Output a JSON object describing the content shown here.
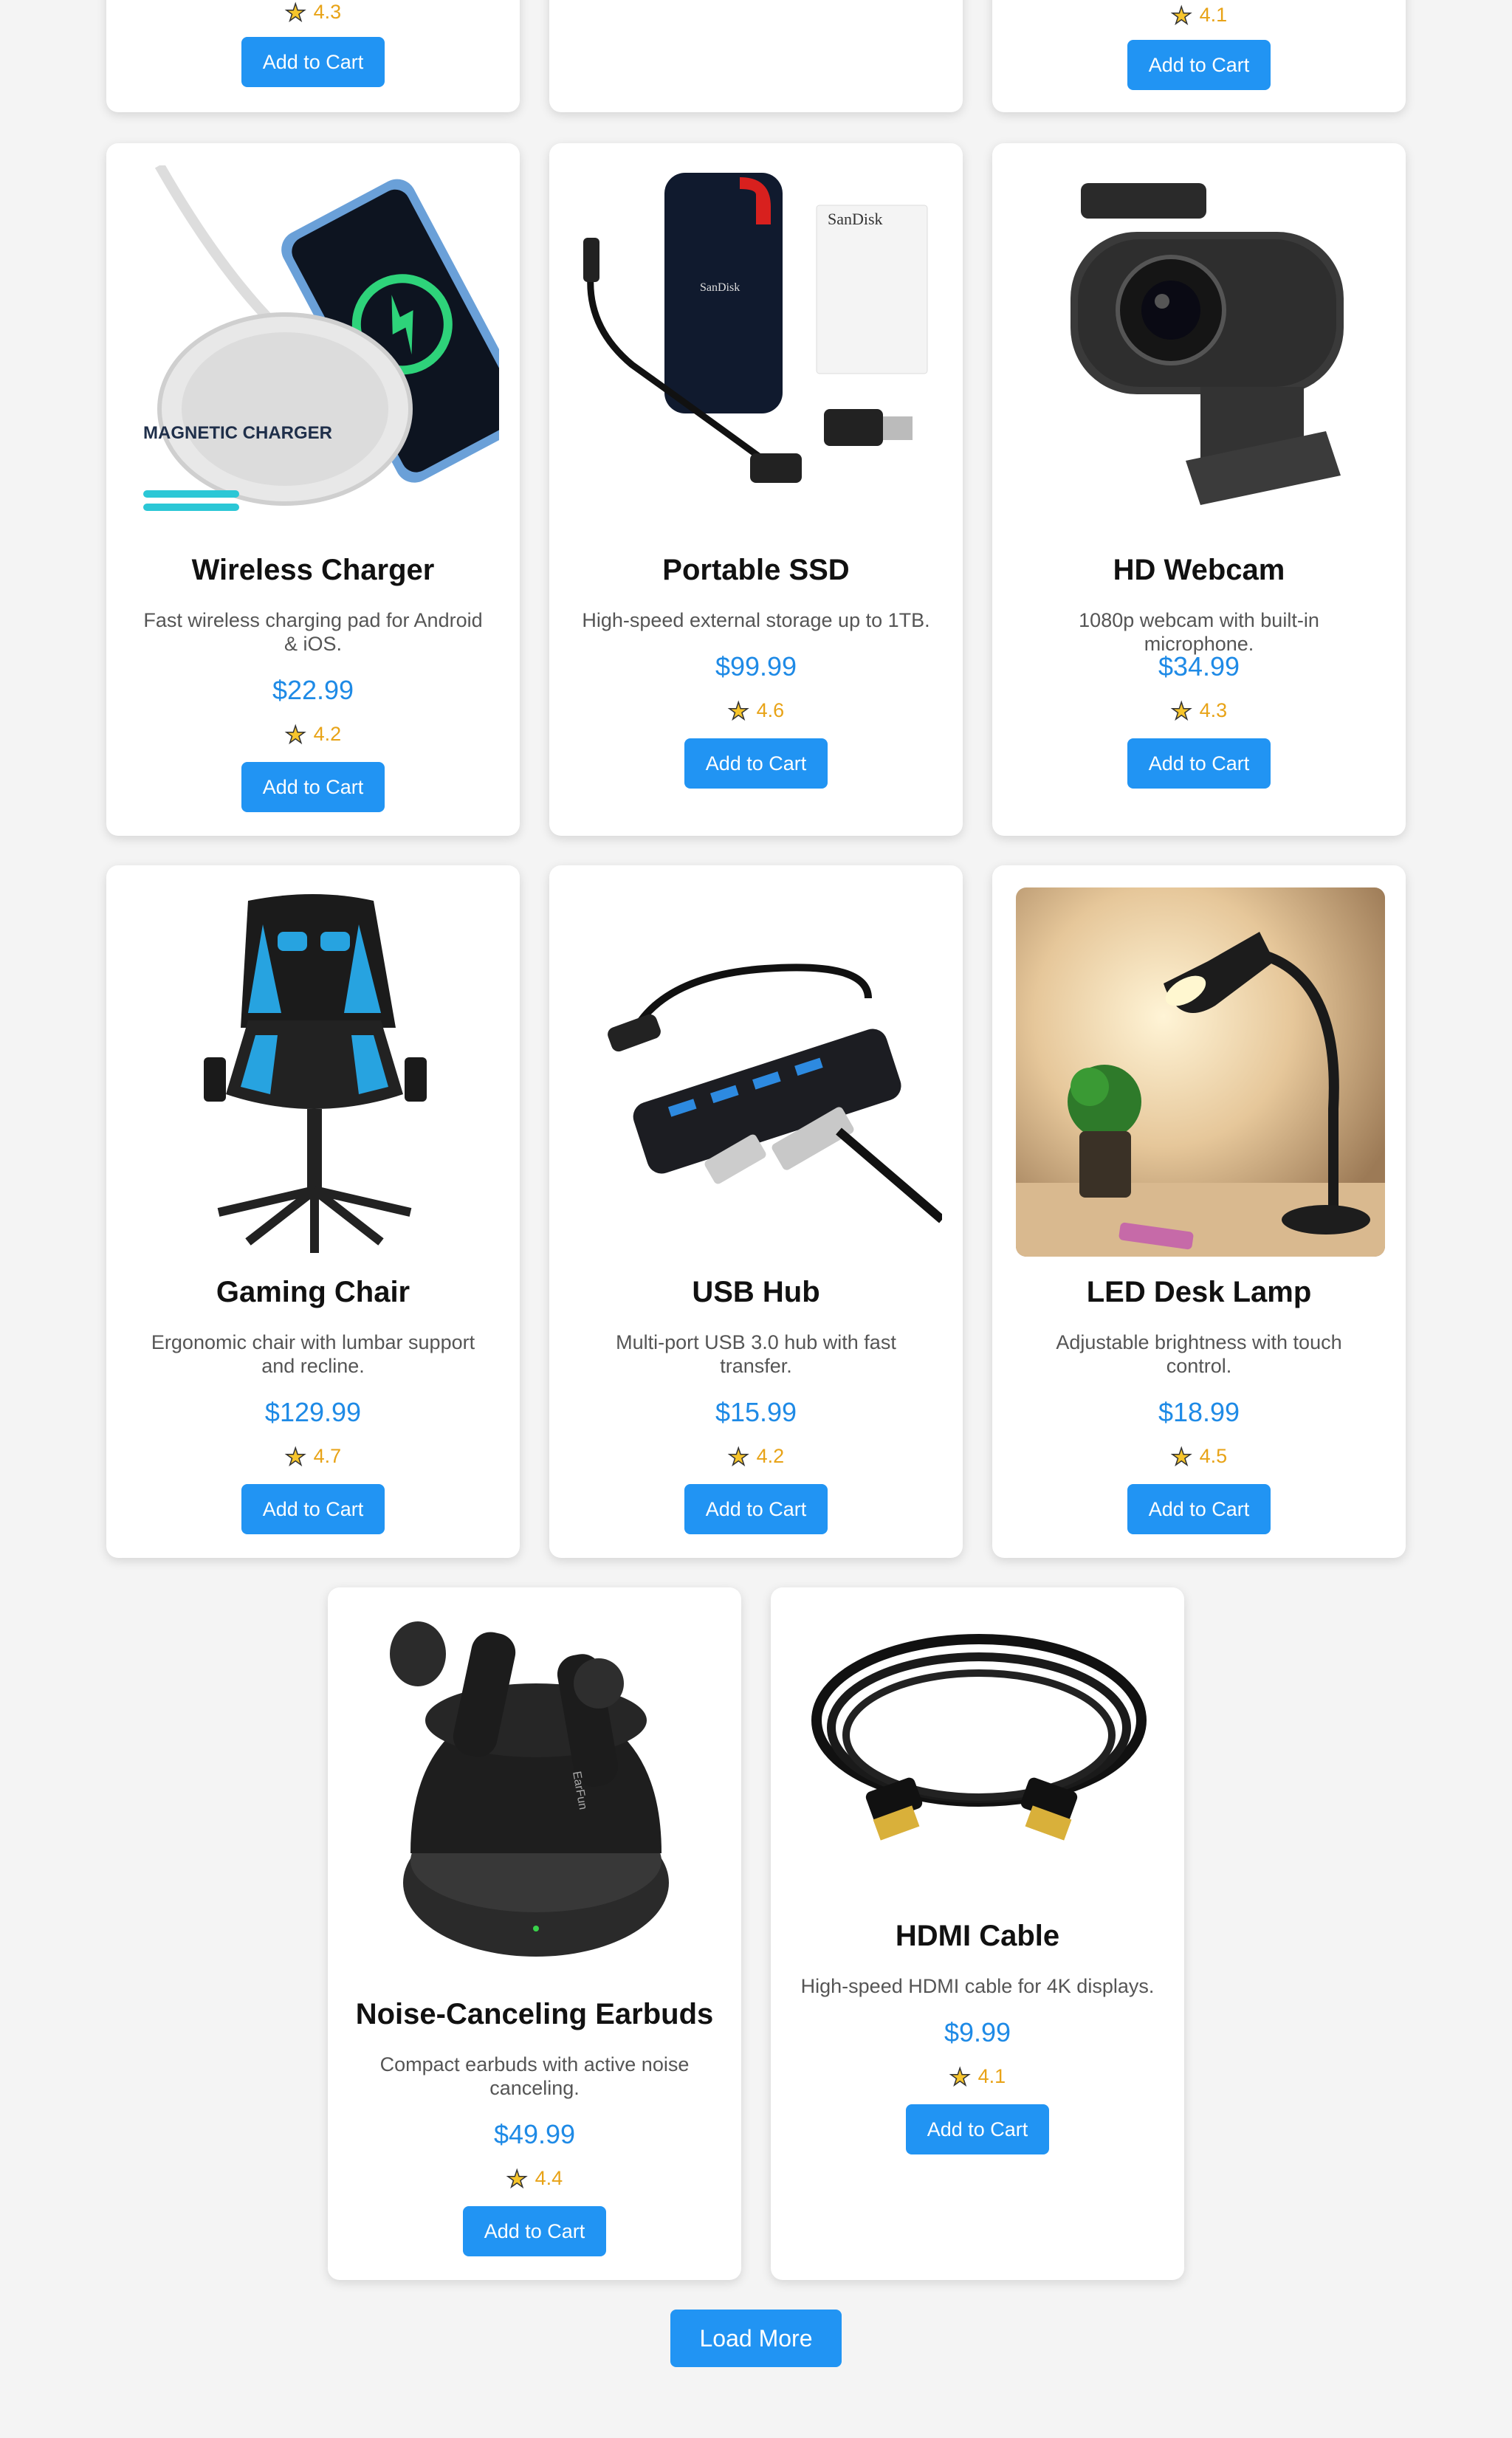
{
  "top_row": [
    {
      "rating": "4.3",
      "button": "Add to Cart"
    },
    {},
    {
      "rating": "4.1",
      "button": "Add to Cart"
    }
  ],
  "products": [
    {
      "name": "Wireless Charger",
      "description": "Fast wireless charging pad for Android & iOS.",
      "price": "$22.99",
      "rating": "4.2",
      "button": "Add to Cart",
      "image": "wireless-charger",
      "image_text": "MAGNETIC CHARGER"
    },
    {
      "name": "Portable SSD",
      "description": "High-speed external storage up to 1TB.",
      "price": "$99.99",
      "rating": "4.6",
      "button": "Add to Cart",
      "image": "portable-ssd",
      "image_text": "SanDisk"
    },
    {
      "name": "HD Webcam",
      "description": "1080p webcam with built-in microphone.",
      "price": "$34.99",
      "rating": "4.3",
      "button": "Add to Cart",
      "image": "webcam"
    },
    {
      "name": "Gaming Chair",
      "description": "Ergonomic chair with lumbar support and recline.",
      "price": "$129.99",
      "rating": "4.7",
      "button": "Add to Cart",
      "image": "gaming-chair"
    },
    {
      "name": "USB Hub",
      "description": "Multi-port USB 3.0 hub with fast transfer.",
      "price": "$15.99",
      "rating": "4.2",
      "button": "Add to Cart",
      "image": "usb-hub"
    },
    {
      "name": "LED Desk Lamp",
      "description": "Adjustable brightness with touch control.",
      "price": "$18.99",
      "rating": "4.5",
      "button": "Add to Cart",
      "image": "desk-lamp"
    },
    {
      "name": "Noise-Canceling Earbuds",
      "description": "Compact earbuds with active noise canceling.",
      "price": "$49.99",
      "rating": "4.4",
      "button": "Add to Cart",
      "image": "earbuds",
      "image_text": "EarFun"
    },
    {
      "name": "HDMI Cable",
      "description": "High-speed HDMI cable for 4K displays.",
      "price": "$9.99",
      "rating": "4.1",
      "button": "Add to Cart",
      "image": "hdmi-cable"
    }
  ],
  "star_icon": "star-icon",
  "load_more": "Load More",
  "colors": {
    "accent": "#2194f3",
    "price": "#1e8ae6",
    "rating": "#e8a317"
  }
}
